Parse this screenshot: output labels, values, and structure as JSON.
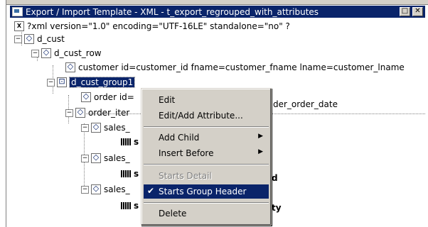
{
  "window": {
    "title": "Export / Import Template - XML - t_export_regrouped_with_attributes",
    "restore_glyph": "□",
    "close_glyph": "✕"
  },
  "tree": {
    "xml_decl_icon": "X",
    "xml_decl": "?xml version=\"1.0\" encoding=\"UTF-16LE\" standalone=\"no\" ?",
    "d_cust": "d_cust",
    "d_cust_row": "d_cust_row",
    "customer": "customer id=customer_id fname=customer_fname lname=customer_lname",
    "d_cust_group": "d_cust_group1",
    "order_prefix": "order id=",
    "order_suffix": "der_order_date",
    "order_item": "order_iter",
    "sales1": "sales_",
    "col1": "s",
    "sales2": "sales_",
    "col2": "s",
    "col2_tail": "d",
    "sales3": "sales_",
    "col3": "s",
    "col3_tail": "ty"
  },
  "context_menu": {
    "items": [
      {
        "label": "Edit"
      },
      {
        "label": "Edit/Add Attribute..."
      },
      {
        "label": "Add Child",
        "submenu": true
      },
      {
        "label": "Insert Before",
        "submenu": true
      },
      {
        "label": "Starts Detail",
        "disabled": true
      },
      {
        "label": "Starts Group Header",
        "checked": true
      },
      {
        "label": "Delete"
      }
    ],
    "arrow_glyph": "▶",
    "check_glyph": "✔"
  },
  "icons": {
    "expanded_glyph": "−"
  }
}
